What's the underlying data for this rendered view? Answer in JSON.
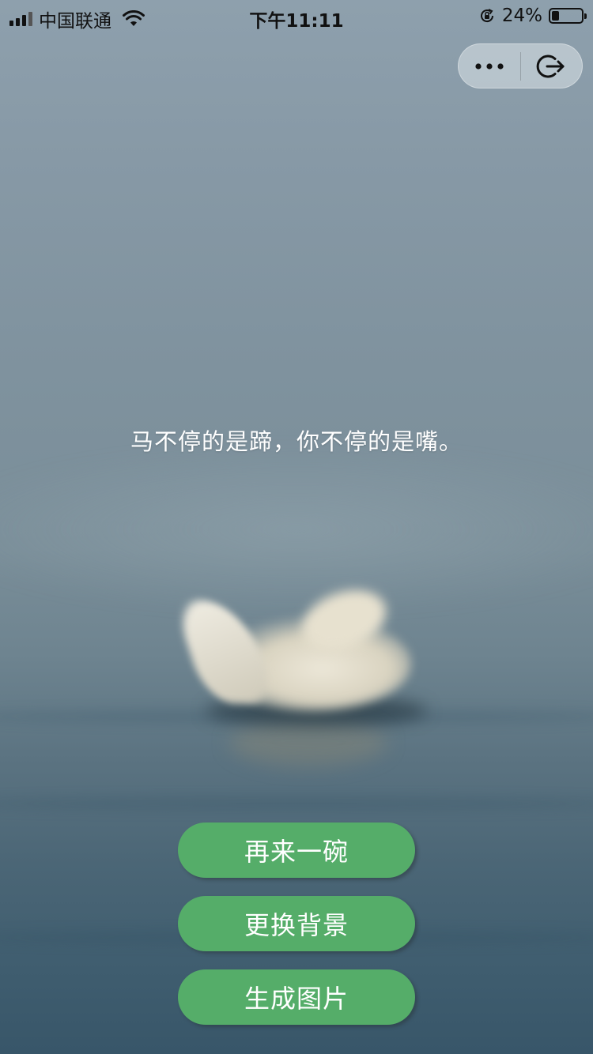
{
  "status_bar": {
    "carrier": "中国联通",
    "time": "下午11:11",
    "battery_percent": "24%",
    "battery_level": 0.24,
    "icons": [
      "signal-icon",
      "wifi-icon",
      "rotation-lock-icon",
      "battery-icon"
    ]
  },
  "capsule": {
    "more_icon": "more-dots-icon",
    "exit_icon": "exit-icon"
  },
  "quote": {
    "text": "马不停的是蹄，你不停的是嘴。"
  },
  "buttons": {
    "again": "再来一碗",
    "change_background": "更换背景",
    "generate_image": "生成图片"
  },
  "colors": {
    "button_green": "#55ad69",
    "text_white": "#ffffff"
  }
}
